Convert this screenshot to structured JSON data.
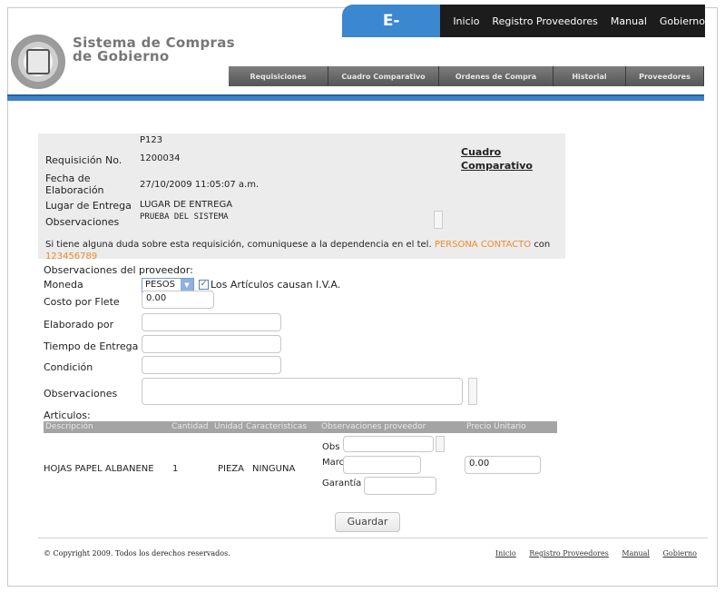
{
  "header": {
    "brand": "E-Compras",
    "nav": [
      "Inicio",
      "Registro Proveedores",
      "Manual",
      "Gobierno"
    ],
    "site_title_line1": "Sistema de Compras",
    "site_title_line2": "de Gobierno",
    "menu": [
      "Requisiciones",
      "Cuadro Comparativo",
      "Ordenes de Compra",
      "Historial",
      "Proveedores"
    ]
  },
  "requisicion": {
    "code": "P123",
    "numero_label": "Requisición No.",
    "numero": "1200034",
    "fecha_label_1": "Fecha de",
    "fecha_label_2": "Elaboración",
    "fecha": "27/10/2009 11:05:07 a.m.",
    "lugar_label": "Lugar de Entrega",
    "lugar": "LUGAR DE ENTREGA",
    "observaciones_label": "Observaciones",
    "observaciones": "PRUEBA DEL SISTEMA",
    "cuadro_link_1": "Cuadro",
    "cuadro_link_2": "Comparativo",
    "contact_text": "Si tiene alguna duda sobre esta requisición, comuniquese a la dependencia en el tel.",
    "contact_person": "PERSONA CONTACTO",
    "contact_con": "con",
    "contact_phone": "123456789"
  },
  "form": {
    "obs_proveedor_label": "Observaciones del proveedor:",
    "moneda_label": "Moneda",
    "moneda_value": "PESOS",
    "iva_label": "Los Artículos causan I.V.A.",
    "flete_label": "Costo por Flete",
    "flete_value": "0.00",
    "elaborado_label": "Elaborado por",
    "tiempo_label": "Tiempo de Entrega",
    "condicion_label": "Condición",
    "observaciones_label": "Observaciones"
  },
  "articulos": {
    "label": "Articulos:",
    "columns": [
      "Descripción",
      "Cantidad",
      "Unidad",
      "Caracteristicas",
      "Observaciones proveedor",
      "Precio Unitario"
    ],
    "rows": [
      {
        "descripcion": "HOJAS PAPEL ALBANENE",
        "cantidad": "1",
        "unidad": "PIEZA",
        "caracteristicas": "NINGUNA",
        "obs_label": "Obs",
        "marca_label": "Marca",
        "garantia_label": "Garantía",
        "precio": "0.00"
      }
    ]
  },
  "actions": {
    "guardar": "Guardar"
  },
  "footer": {
    "copyright": "© Copyright 2009. Todos los derechos reservados.",
    "links": [
      "Inicio",
      "Registro Proveedores",
      "Manual",
      "Gobierno"
    ]
  }
}
